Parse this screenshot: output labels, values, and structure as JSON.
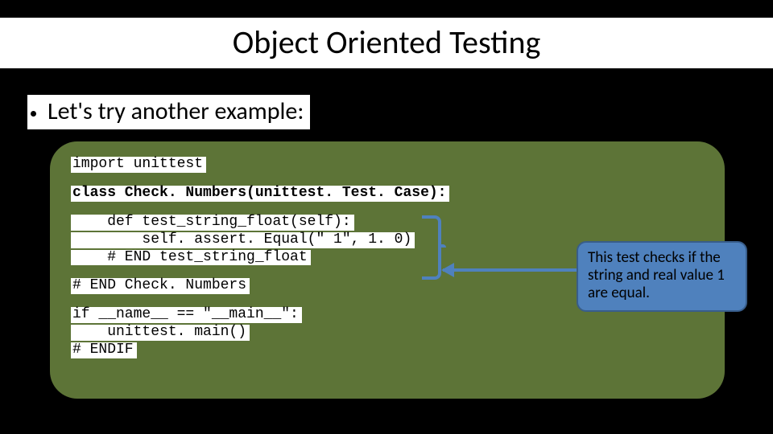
{
  "title": "Object Oriented Testing",
  "bullet": "Let's try another example:",
  "code": {
    "l1": "import unittest",
    "l2": "class Check. Numbers(unittest. Test. Case):",
    "l3": "    def test_string_float(self):",
    "l4": "        self. assert. Equal(\" 1\", 1. 0)",
    "l5": "    # END test_string_float",
    "l6": "# END Check. Numbers",
    "l7": "if __name__ == \"__main__\":",
    "l8": "    unittest. main()",
    "l9": "# ENDIF"
  },
  "callout": "This test checks if the string and real value 1 are equal."
}
